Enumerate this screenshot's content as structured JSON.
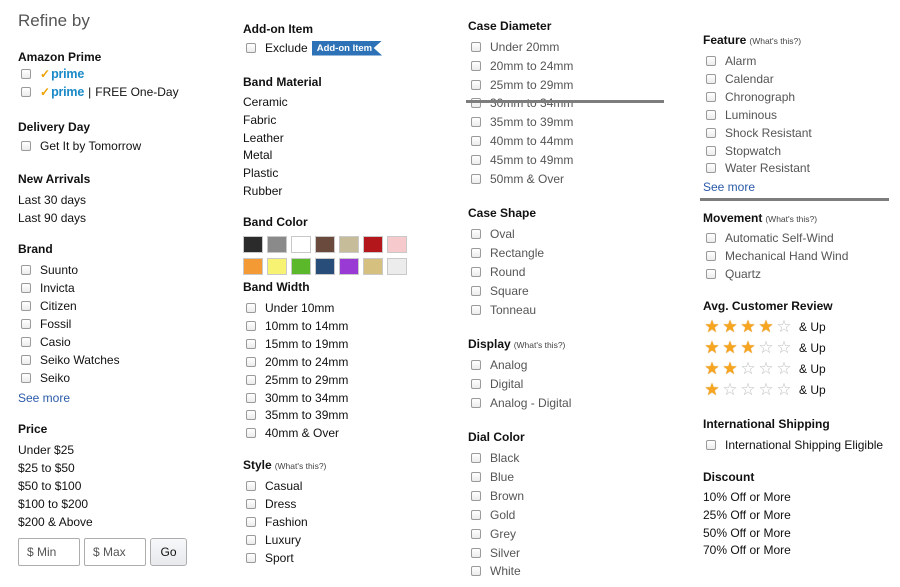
{
  "header": {
    "title": "Refine by"
  },
  "amazon_prime": {
    "title": "Amazon Prime",
    "prime_label": "prime",
    "one_day_label": "FREE One-Day"
  },
  "delivery_day": {
    "title": "Delivery Day",
    "item": "Get It by Tomorrow"
  },
  "new_arrivals": {
    "title": "New Arrivals",
    "items": [
      "Last 30 days",
      "Last 90 days"
    ]
  },
  "brand": {
    "title": "Brand",
    "items": [
      "Suunto",
      "Invicta",
      "Citizen",
      "Fossil",
      "Casio",
      "Seiko Watches",
      "Seiko"
    ],
    "see_more": "See more"
  },
  "price": {
    "title": "Price",
    "items": [
      "Under $25",
      "$25 to $50",
      "$50 to $100",
      "$100 to $200",
      "$200 & Above"
    ],
    "min_placeholder": "$ Min",
    "max_placeholder": "$ Max",
    "go_label": "Go"
  },
  "addon": {
    "title": "Add-on Item",
    "exclude_label": "Exclude",
    "badge": "Add-on Item"
  },
  "band_material": {
    "title": "Band Material",
    "items": [
      "Ceramic",
      "Fabric",
      "Leather",
      "Metal",
      "Plastic",
      "Rubber"
    ]
  },
  "band_color": {
    "title": "Band Color",
    "swatches": [
      "#2b2b2b",
      "#8a8a8a",
      "#ffffff",
      "#6b4a3e",
      "#c7bc9a",
      "#b3161b",
      "#f6c9cd",
      "#f39a35",
      "#f7f271",
      "#5bb82a",
      "#274d78",
      "#9a3ad4",
      "#d5c07f",
      "#ececec"
    ]
  },
  "band_width": {
    "title": "Band Width",
    "items": [
      "Under 10mm",
      "10mm to 14mm",
      "15mm to 19mm",
      "20mm to 24mm",
      "25mm to 29mm",
      "30mm to 34mm",
      "35mm to 39mm",
      "40mm & Over"
    ]
  },
  "style": {
    "title": "Style",
    "whats_this": "(What's this?)",
    "items": [
      "Casual",
      "Dress",
      "Fashion",
      "Luxury",
      "Sport"
    ]
  },
  "case_diameter": {
    "title": "Case Diameter",
    "items": [
      "Under 20mm",
      "20mm to 24mm",
      "25mm to 29mm",
      "30mm to 34mm",
      "35mm to 39mm",
      "40mm to 44mm",
      "45mm to 49mm",
      "50mm & Over"
    ]
  },
  "case_shape": {
    "title": "Case Shape",
    "items": [
      "Oval",
      "Rectangle",
      "Round",
      "Square",
      "Tonneau"
    ]
  },
  "display": {
    "title": "Display",
    "whats_this": "(What's this?)",
    "items": [
      "Analog",
      "Digital",
      "Analog - Digital"
    ]
  },
  "dial_color": {
    "title": "Dial Color",
    "items": [
      "Black",
      "Blue",
      "Brown",
      "Gold",
      "Grey",
      "Silver",
      "White"
    ]
  },
  "feature": {
    "title": "Feature",
    "whats_this": "(What's this?)",
    "items": [
      "Alarm",
      "Calendar",
      "Chronograph",
      "Luminous",
      "Shock Resistant",
      "Stopwatch",
      "Water Resistant"
    ],
    "see_more": "See more"
  },
  "movement": {
    "title": "Movement",
    "whats_this": "(What's this?)",
    "items": [
      "Automatic Self-Wind",
      "Mechanical Hand Wind",
      "Quartz"
    ]
  },
  "reviews": {
    "title": "Avg. Customer Review",
    "and_up": "& Up",
    "ratings": [
      4,
      3,
      2,
      1
    ]
  },
  "intl_shipping": {
    "title": "International Shipping",
    "item": "International Shipping Eligible"
  },
  "discount": {
    "title": "Discount",
    "items": [
      "10% Off or More",
      "25% Off or More",
      "50% Off or More",
      "70% Off or More"
    ]
  },
  "colors": {
    "link": "#2a5aa8",
    "prime": "#1a8ac8",
    "star": "#f7a51e",
    "addon_badge": "#2d72b6"
  }
}
